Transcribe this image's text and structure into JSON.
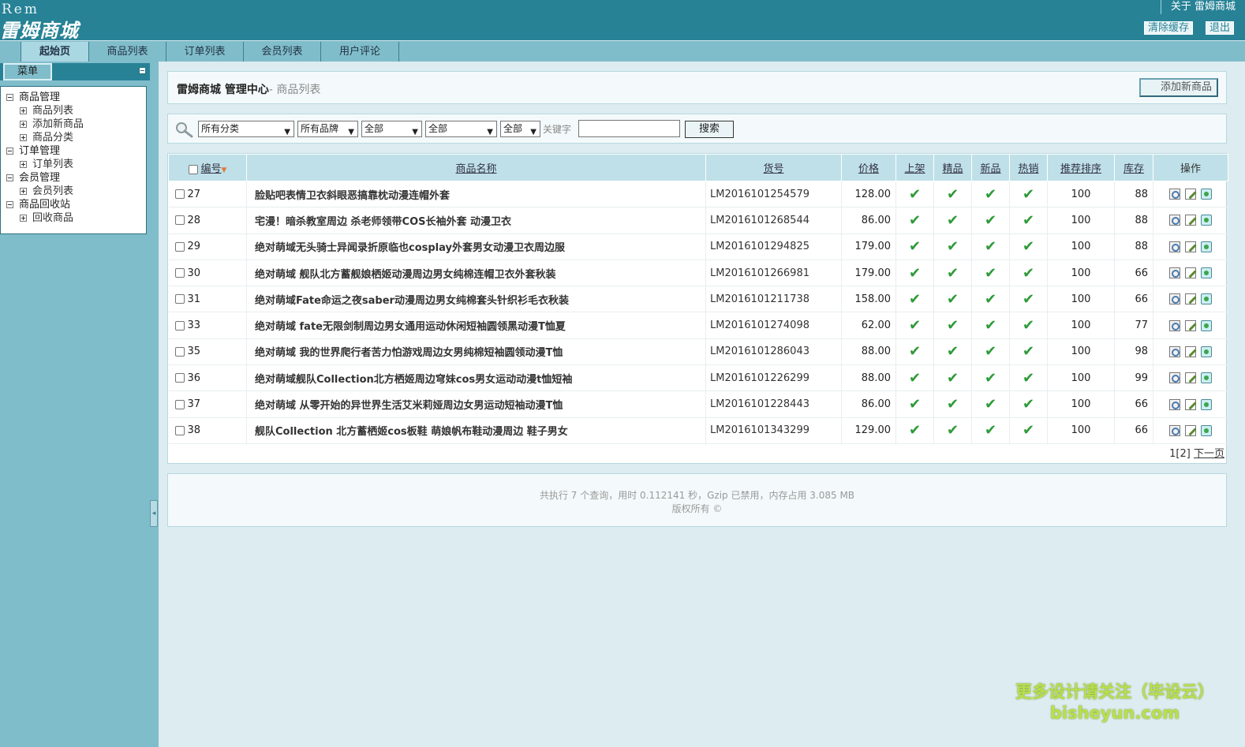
{
  "header": {
    "logo_en": "Rem",
    "logo_cn": "雷姆商城",
    "about": "关于 雷姆商城",
    "clear_cache": "清除缓存",
    "logout": "退出"
  },
  "tabs": [
    "起始页",
    "商品列表",
    "订单列表",
    "会员列表",
    "用户评论"
  ],
  "sidebar": {
    "menu_label": "菜单",
    "groups": [
      {
        "label": "商品管理",
        "items": [
          "商品列表",
          "添加新商品",
          "商品分类"
        ]
      },
      {
        "label": "订单管理",
        "items": [
          "订单列表"
        ]
      },
      {
        "label": "会员管理",
        "items": [
          "会员列表"
        ]
      },
      {
        "label": "商品回收站",
        "items": [
          "回收商品"
        ]
      }
    ]
  },
  "page": {
    "title": "雷姆商城 管理中心",
    "subtitle": "- 商品列表",
    "add_button": "添加新商品"
  },
  "search": {
    "category": "所有分类",
    "brand": "所有品牌",
    "filter1": "全部",
    "filter2": "全部",
    "filter3": "全部",
    "keyword_label": "关键字",
    "keyword_value": "",
    "button": "搜索"
  },
  "table": {
    "headers": {
      "id": "编号",
      "name": "商品名称",
      "sn": "货号",
      "price": "价格",
      "on_sale": "上架",
      "best": "精品",
      "new": "新品",
      "hot": "热销",
      "sort": "推荐排序",
      "stock": "库存",
      "ops": "操作"
    },
    "rows": [
      {
        "id": "27",
        "name": "脸贴吧表情卫衣斜眼恶搞靠枕动漫连帽外套",
        "sn": "LM2016101254579",
        "price": "128.00",
        "sort": "100",
        "stock": "88"
      },
      {
        "id": "28",
        "name": "宅漫！暗杀教室周边 杀老师领带COS长袖外套 动漫卫衣",
        "sn": "LM2016101268544",
        "price": "86.00",
        "sort": "100",
        "stock": "88"
      },
      {
        "id": "29",
        "name": "绝对萌域无头骑士异闻录折原临也cosplay外套男女动漫卫衣周边服",
        "sn": "LM2016101294825",
        "price": "179.00",
        "sort": "100",
        "stock": "88"
      },
      {
        "id": "30",
        "name": "绝对萌域 舰队北方蓄舰娘栖姬动漫周边男女纯棉连帽卫衣外套秋装",
        "sn": "LM2016101266981",
        "price": "179.00",
        "sort": "100",
        "stock": "66"
      },
      {
        "id": "31",
        "name": "绝对萌域Fate命运之夜saber动漫周边男女纯棉套头针织衫毛衣秋装",
        "sn": "LM2016101211738",
        "price": "158.00",
        "sort": "100",
        "stock": "66"
      },
      {
        "id": "33",
        "name": "绝对萌域 fate无限剑制周边男女通用运动休闲短袖圆领黑动漫T恤夏",
        "sn": "LM2016101274098",
        "price": "62.00",
        "sort": "100",
        "stock": "77"
      },
      {
        "id": "35",
        "name": "绝对萌域 我的世界爬行者苦力怕游戏周边女男纯棉短袖圆领动漫T恤",
        "sn": "LM2016101286043",
        "price": "88.00",
        "sort": "100",
        "stock": "98"
      },
      {
        "id": "36",
        "name": "绝对萌域舰队Collection北方栖姬周边穹妹cos男女运动动漫t恤短袖",
        "sn": "LM2016101226299",
        "price": "88.00",
        "sort": "100",
        "stock": "99"
      },
      {
        "id": "37",
        "name": "绝对萌域 从零开始的异世界生活艾米莉娅周边女男运动短袖动漫T恤",
        "sn": "LM2016101228443",
        "price": "86.00",
        "sort": "100",
        "stock": "66"
      },
      {
        "id": "38",
        "name": "舰队Collection 北方蓄栖姬cos板鞋 萌娘帆布鞋动漫周边 鞋子男女",
        "sn": "LM2016101343299",
        "price": "129.00",
        "sort": "100",
        "stock": "66"
      }
    ],
    "check_mark": "✔"
  },
  "pager": {
    "pages": "1[2]",
    "next": "下一页"
  },
  "footer": {
    "stats": "共执行 7 个查询，用时 0.112141 秒，Gzip 已禁用，内存占用 3.085 MB",
    "copyright": "版权所有 ©"
  },
  "watermark": {
    "line1": "更多设计请关注（毕设云）",
    "line2": "bisheyun.com"
  }
}
